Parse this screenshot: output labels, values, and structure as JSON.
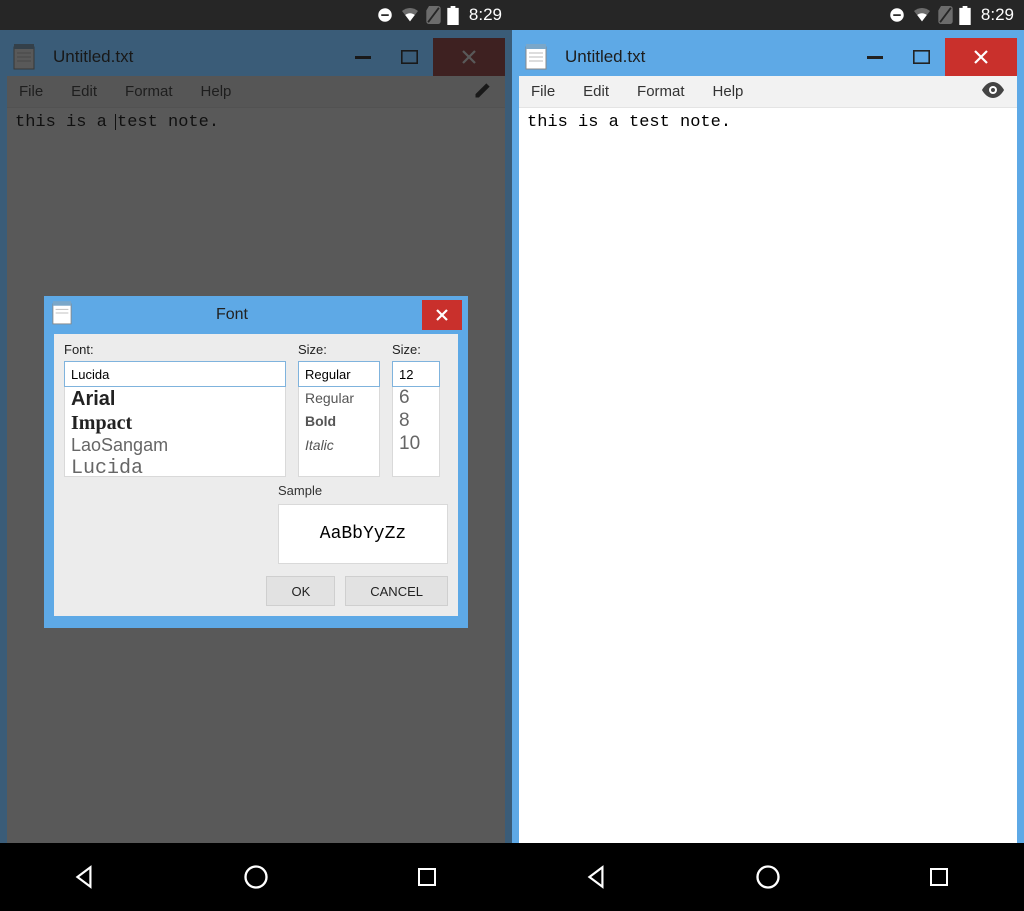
{
  "status": {
    "time": "8:29"
  },
  "window": {
    "title": "Untitled.txt",
    "menus": {
      "file": "File",
      "edit": "Edit",
      "format": "Format",
      "help": "Help"
    }
  },
  "editor": {
    "content": "this is a test note."
  },
  "dialog": {
    "title": "Font",
    "labels": {
      "font": "Font:",
      "style": "Size:",
      "size": "Size:",
      "sample": "Sample"
    },
    "font_input": "Lucida",
    "style_input": "Regular",
    "size_input": "12",
    "font_options": [
      "Arial",
      "Impact",
      "LaoSangam",
      "Lucida"
    ],
    "style_options": [
      "Regular",
      "Bold",
      "Italic"
    ],
    "size_options": [
      "6",
      "8",
      "10"
    ],
    "sample_text": "AaBbYyZz",
    "ok": "OK",
    "cancel": "CANCEL"
  }
}
